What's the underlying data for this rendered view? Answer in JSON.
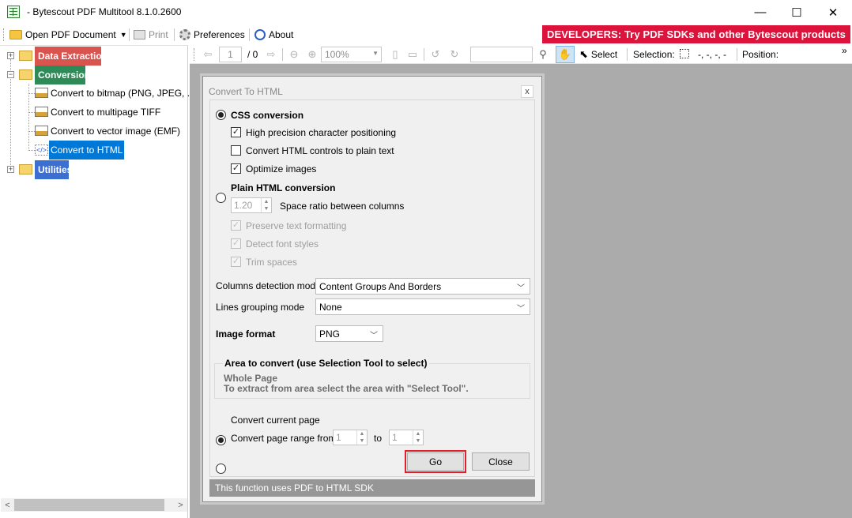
{
  "window": {
    "title": "- Bytescout PDF Multitool 8.1.0.2600",
    "minimize": "—",
    "maximize": "☐",
    "close": "✕"
  },
  "toolbar": {
    "open_label": "Open PDF Document",
    "print_label": "Print",
    "preferences_label": "Preferences",
    "about_label": "About",
    "banner": "DEVELOPERS: Try PDF SDKs and other Bytescout products"
  },
  "tree": {
    "categories": [
      {
        "label": "Data Extraction",
        "color": "#d9534f"
      },
      {
        "label": "Conversion",
        "color": "#2e8b57"
      },
      {
        "label": "Utilities",
        "color": "#3b6fd1"
      }
    ],
    "conversion_items": [
      "Convert to bitmap (PNG, JPEG, ...)",
      "Convert to multipage TIFF",
      "Convert to vector image (EMF)",
      "Convert to HTML"
    ],
    "selected_item": "Convert to HTML"
  },
  "viewer_toolbar": {
    "page_current": "1",
    "page_total": "/ 0",
    "zoom": "100%",
    "select_label": "Select",
    "selection_label": "Selection:",
    "selection_value": "-, -, -, -",
    "position_label": "Position:",
    "overflow": "»"
  },
  "dialog": {
    "title": "Convert To HTML",
    "close": "x",
    "css_conversion": "CSS conversion",
    "opt_high_precision": "High precision character positioning",
    "opt_controls_plain": "Convert HTML controls to plain text",
    "opt_optimize_images": "Optimize images",
    "plain_conversion": "Plain HTML conversion",
    "space_ratio_value": "1.20",
    "space_ratio_label": "Space ratio between columns",
    "opt_preserve_format": "Preserve text formatting",
    "opt_detect_fonts": "Detect font styles",
    "opt_trim_spaces": "Trim spaces",
    "columns_mode_label": "Columns detection mode",
    "columns_mode_value": "Content Groups And Borders",
    "lines_mode_label": "Lines grouping mode",
    "lines_mode_value": "None",
    "image_format_label": "Image format",
    "image_format_value": "PNG",
    "area_title": "Area to convert (use Selection Tool to select)",
    "area_line1": "Whole Page",
    "area_line2": "To extract from area select the area with \"Select Tool\".",
    "convert_current": "Convert current page",
    "convert_range": "Convert page range from",
    "range_from": "1",
    "range_to_label": "to",
    "range_to": "1",
    "go_label": "Go",
    "close_label": "Close",
    "footer": "This function uses PDF to HTML SDK",
    "go_highlight_color": "#e0202a"
  }
}
